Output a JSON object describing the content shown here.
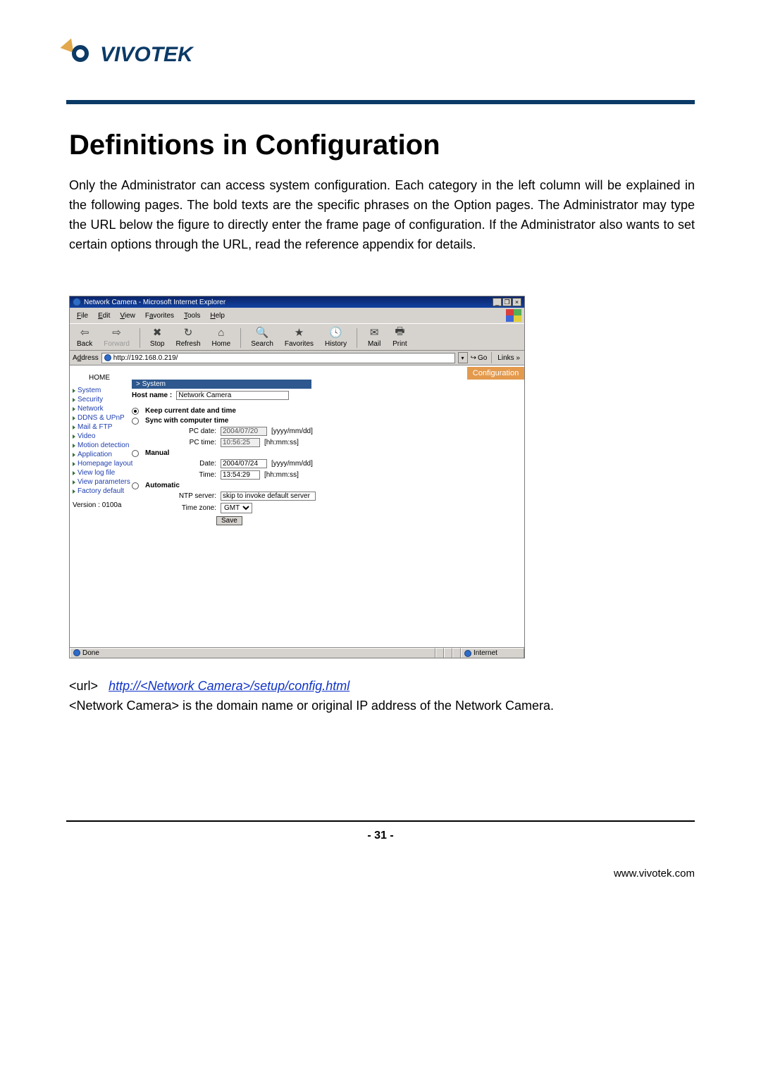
{
  "logo": {
    "text": "VIVOTEK"
  },
  "section_title": "Definitions in Configuration",
  "intro_paragraph": "Only the Administrator can access system configuration. Each category in the left column will be explained in the following pages. The bold texts are the specific phrases on the Option pages. The Administrator may type the URL below the figure to directly enter the frame page of configuration. If the Administrator also wants to set certain options through the URL, read the reference appendix for details.",
  "browser": {
    "title": "Network Camera - Microsoft Internet Explorer",
    "menus": {
      "file": "File",
      "edit": "Edit",
      "view": "View",
      "favorites": "Favorites",
      "tools": "Tools",
      "help": "Help"
    },
    "toolbar": {
      "back": "Back",
      "forward": "Forward",
      "stop": "Stop",
      "refresh": "Refresh",
      "home": "Home",
      "search": "Search",
      "favorites": "Favorites",
      "history": "History",
      "mail": "Mail",
      "print": "Print"
    },
    "address_label": "Address",
    "address_value": "http://192.168.0.219/",
    "go": "Go",
    "links": "Links",
    "status_done": "Done",
    "status_zone": "Internet"
  },
  "sidebar": {
    "home": "HOME",
    "items": [
      "System",
      "Security",
      "Network",
      "DDNS & UPnP",
      "Mail & FTP",
      "Video",
      "Motion detection",
      "Application",
      "Homepage layout",
      "View log file",
      "View parameters",
      "Factory default"
    ],
    "version": "Version : 0100a"
  },
  "config": {
    "banner": "Configuration",
    "panel_title": "> System",
    "hostname_label": "Host name :",
    "hostname_value": "Network Camera",
    "opt_keep": "Keep current date and time",
    "opt_sync": "Sync with computer time",
    "pc_date_label": "PC date:",
    "pc_date_value": "2004/07/20",
    "date_fmt": "[yyyy/mm/dd]",
    "pc_time_label": "PC time:",
    "pc_time_value": "10:56:25",
    "time_fmt": "[hh:mm:ss]",
    "opt_manual": "Manual",
    "man_date_label": "Date:",
    "man_date_value": "2004/07/24",
    "man_time_label": "Time:",
    "man_time_value": "13:54:29",
    "opt_auto": "Automatic",
    "ntp_label": "NTP server:",
    "ntp_value": "skip to invoke default server",
    "tz_label": "Time zone:",
    "tz_value": "GMT",
    "save": "Save"
  },
  "below": {
    "url_label": "<url>",
    "url_link": "http://<Network Camera>/setup/config.html",
    "domain_note": "<Network Camera> is the domain name or original IP address of the Network Camera."
  },
  "page_number": "- 31 -",
  "footer_url": "www.vivotek.com"
}
